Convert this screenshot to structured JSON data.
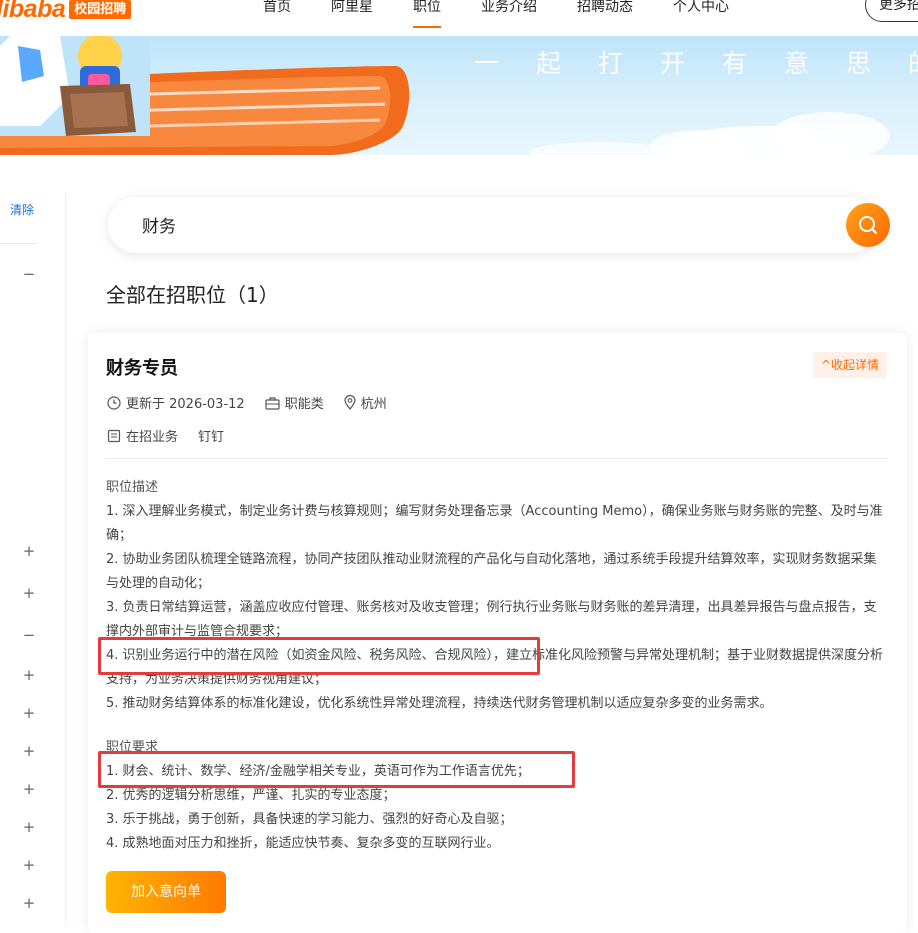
{
  "nav": {
    "logo_text": "libaba",
    "logo_badge": "校园招聘",
    "items": [
      {
        "label": "首页"
      },
      {
        "label": "阿里星"
      },
      {
        "label": "职位"
      },
      {
        "label": "业务介绍"
      },
      {
        "label": "招聘动态"
      },
      {
        "label": "个人中心"
      }
    ],
    "active_index": 2,
    "more_button": "更多招",
    "accent": "#ff6a00"
  },
  "banner": {
    "slogan": "一起打开有意思的未"
  },
  "sidebar": {
    "clear_label": "清除",
    "toggles": [
      "−",
      "+",
      "+",
      "−",
      "+",
      "+",
      "+",
      "+",
      "+",
      "+",
      "+"
    ]
  },
  "search": {
    "value": "财务",
    "button_icon": "search-icon"
  },
  "results": {
    "heading": "全部在招职位（1）"
  },
  "job": {
    "title": "财务专员",
    "collapse_label": "^收起详情",
    "updated": "更新于 2026-03-12",
    "category": "职能类",
    "location": "杭州",
    "business_label": "在招业务",
    "business": "钉钉",
    "description_title": "职位描述",
    "description": [
      "1. 深入理解业务模式，制定业务计费与核算规则；编写财务处理备忘录（Accounting Memo），确保业务账与财务账的完整、及时与准确；",
      "2. 协助业务团队梳理全链路流程，协同产技团队推动业财流程的产品化与自动化落地，通过系统手段提升结算效率，实现财务数据采集与处理的自动化；",
      "3. 负责日常结算运营，涵盖应收应付管理、账务核对及收支管理；例行执行业务账与财务账的差异清理，出具差异报告与盘点报告，支撑内外部审计与监管合规要求；",
      "4. 识别业务运行中的潜在风险（如资金风险、税务风险、合规风险），建立标准化风险预警与异常处理机制；基于业财数据提供深度分析支持，为业务决策提供财务视角建议；",
      "5. 推动财务结算体系的标准化建设，优化系统性异常处理流程，持续迭代财务管理机制以适应复杂多变的业务需求。"
    ],
    "requirements_title": "职位要求",
    "requirements": [
      "1. 财会、统计、数学、经济/金融学相关专业，英语可作为工作语言优先；",
      "2. 优秀的逻辑分析思维，严谨、扎实的专业态度；",
      "3. 乐于挑战，勇于创新，具备快速的学习能力、强烈的好奇心及自驱；",
      "4. 成熟地面对压力和挫折，能适应快节奏、复杂多变的互联网行业。"
    ],
    "apply_label": "加入意向单",
    "highlight_color": "#e53b3b"
  }
}
